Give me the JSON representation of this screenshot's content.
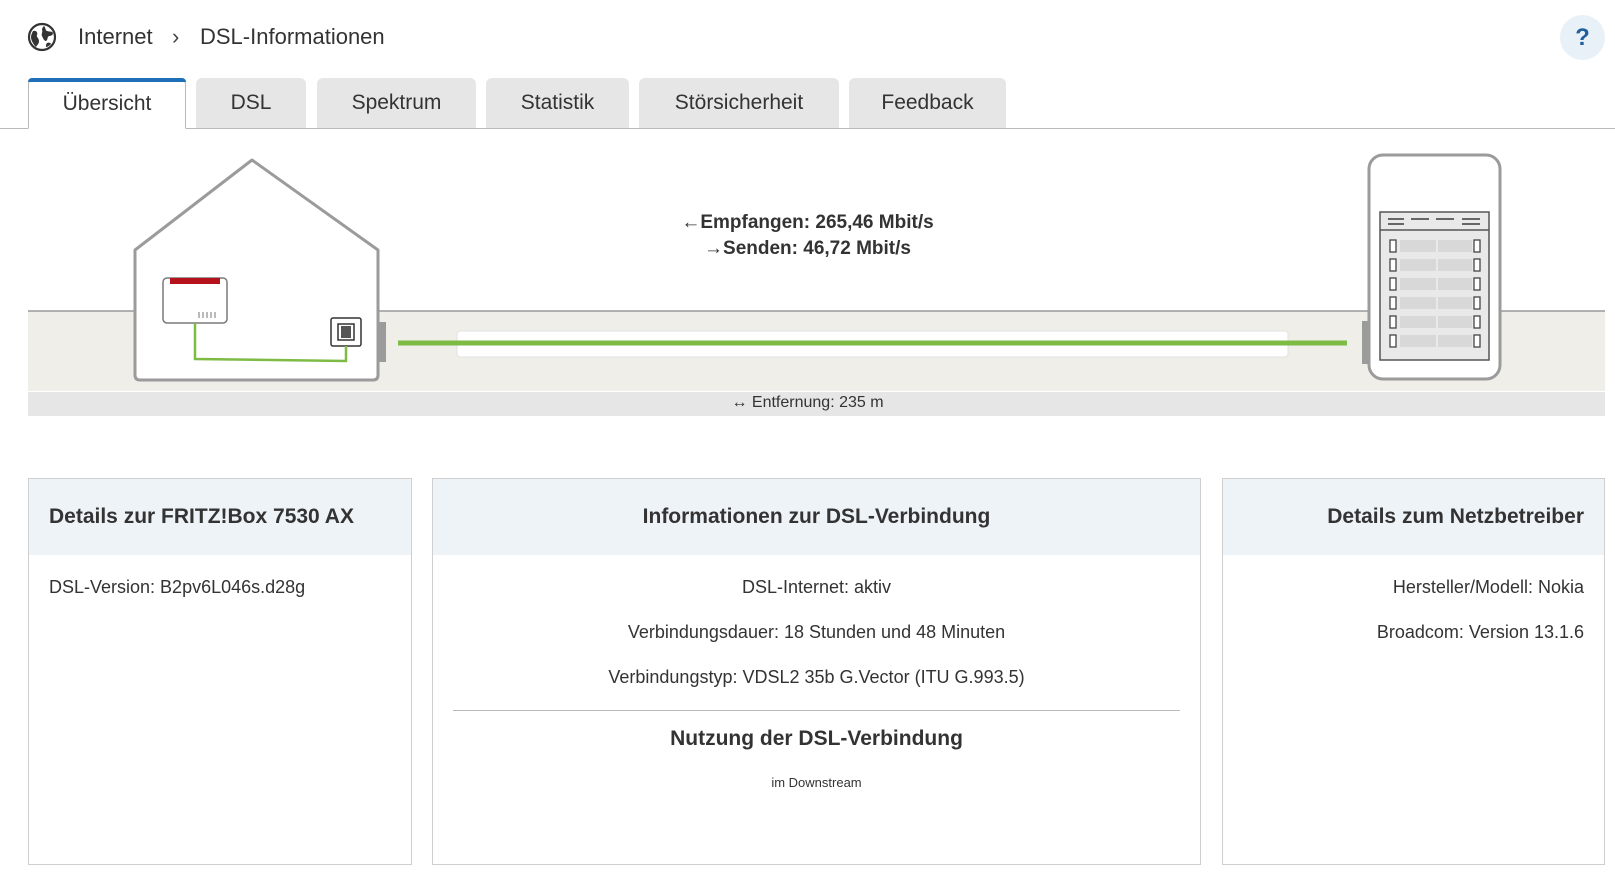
{
  "breadcrumb": {
    "items": [
      "Internet",
      "DSL-Informationen"
    ],
    "separator": "›"
  },
  "help_label": "?",
  "tabs": [
    "Übersicht",
    "DSL",
    "Spektrum",
    "Statistik",
    "Störsicherheit",
    "Feedback"
  ],
  "active_tab": "Übersicht",
  "diagram": {
    "receive": "Empfangen: 265,46 Mbit/s",
    "send": "Senden: 46,72 Mbit/s",
    "distance": "Entfernung: 235 m",
    "line_color": "#7dbb44",
    "router_accent": "#b5121b"
  },
  "cards": {
    "fritzbox": {
      "title": "Details zur FRITZ!Box 7530 AX",
      "lines": [
        "DSL-Version: B2pv6L046s.d28g"
      ]
    },
    "connection": {
      "title": "Informationen zur DSL-Verbindung",
      "lines": [
        "DSL-Internet: aktiv",
        "Verbindungsdauer: 18 Stunden und 48 Minuten",
        "Verbindungstyp: VDSL2 35b G.Vector (ITU G.993.5)"
      ],
      "usage_title": "Nutzung der DSL-Verbindung",
      "usage_sub": "im Downstream"
    },
    "operator": {
      "title": "Details zum Netzbetreiber",
      "lines": [
        "Hersteller/Modell: Nokia",
        "Broadcom: Version 13.1.6"
      ]
    }
  }
}
